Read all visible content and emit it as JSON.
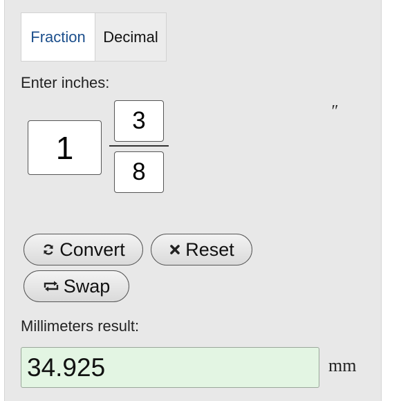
{
  "tabs": [
    {
      "label": "Fraction",
      "active": true
    },
    {
      "label": "Decimal",
      "active": false
    }
  ],
  "input": {
    "label": "Enter inches:",
    "whole": "1",
    "numerator": "3",
    "denominator": "8",
    "unit_symbol": "″"
  },
  "buttons": {
    "convert": "Convert",
    "reset": "Reset",
    "swap": "Swap"
  },
  "result": {
    "label": "Millimeters result:",
    "value": "34.925",
    "unit": "mm"
  },
  "colors": {
    "active_tab_text": "#1c4f8c",
    "panel_bg": "#e8e8e8",
    "result_bg": "#e3f5e3"
  },
  "icons": {
    "convert": "refresh-icon",
    "reset": "close-icon",
    "swap": "swap-icon"
  }
}
